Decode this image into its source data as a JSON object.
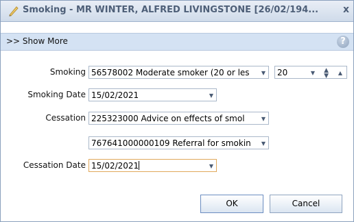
{
  "window": {
    "title": "Smoking - MR WINTER, ALFRED LIVINGSTONE [26/02/194...",
    "close_glyph": "x",
    "accent": "#4e5f78"
  },
  "showmore": {
    "label": ">> Show More",
    "help_glyph": "?"
  },
  "form": {
    "smoking_label": "Smoking",
    "smoking_value": "56578002 Moderate smoker (20 or les",
    "smoking_qty": "20",
    "smoking_date_label": "Smoking Date",
    "smoking_date_value": "15/02/2021",
    "cessation_label": "Cessation",
    "cessation_value_1": "225323000 Advice on effects of smol",
    "cessation_value_2": "767641000000109 Referral for smokin",
    "cessation_date_label": "Cessation Date",
    "cessation_date_value": "15/02/2021"
  },
  "buttons": {
    "ok": "OK",
    "cancel": "Cancel"
  }
}
